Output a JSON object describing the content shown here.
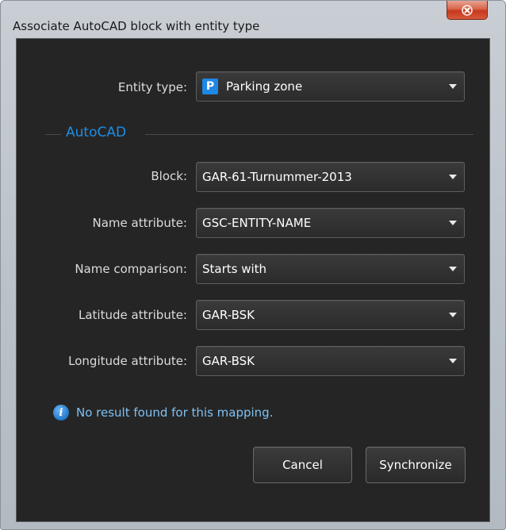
{
  "window": {
    "title": "Associate AutoCAD block with entity type",
    "close_icon": "close-icon"
  },
  "form": {
    "entity_type": {
      "label": "Entity type:",
      "value": "Parking zone",
      "icon_letter": "P",
      "icon_color": "#1e88e5"
    },
    "section_title": "AutoCAD",
    "block": {
      "label": "Block:",
      "value": "GAR-61-Turnummer-2013"
    },
    "name_attribute": {
      "label": "Name attribute:",
      "value": "GSC-ENTITY-NAME"
    },
    "name_comparison": {
      "label": "Name comparison:",
      "value": "Starts with"
    },
    "latitude_attribute": {
      "label": "Latitude attribute:",
      "value": "GAR-BSK"
    },
    "longitude_attribute": {
      "label": "Longitude attribute:",
      "value": "GAR-BSK"
    }
  },
  "info": {
    "icon": "info-icon",
    "text": "No result found for this mapping."
  },
  "buttons": {
    "cancel": "Cancel",
    "synchronize": "Synchronize"
  },
  "colors": {
    "accent": "#1c8ee6",
    "client_bg": "#252525",
    "info_text": "#7ec1f2"
  }
}
